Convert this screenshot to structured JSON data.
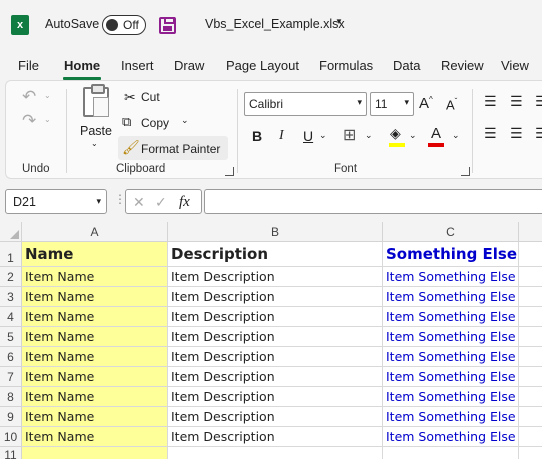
{
  "titlebar": {
    "app_icon": "excel-logo-icon",
    "app_icon_letter": "x",
    "autosave_label": "AutoSave",
    "autosave_state": "Off",
    "filename": "Vbs_Excel_Example.xlsx",
    "brand_color": "#107c41"
  },
  "menu": {
    "tabs": [
      "File",
      "Home",
      "Insert",
      "Draw",
      "Page Layout",
      "Formulas",
      "Data",
      "Review",
      "View"
    ],
    "active": "Home"
  },
  "ribbon": {
    "undo_group": {
      "label": "Undo"
    },
    "clipboard": {
      "label": "Clipboard",
      "paste": "Paste",
      "cut": "Cut",
      "copy": "Copy",
      "format_painter": "Format Painter"
    },
    "font": {
      "label": "Font",
      "font_name": "Calibri",
      "font_size": "11",
      "bold": "B",
      "italic": "I",
      "underline": "U",
      "grow": "A",
      "shrink": "A",
      "font_color_letter": "A",
      "highlight_color": "#ffff00",
      "font_color": "#e00000"
    }
  },
  "formula_bar": {
    "name_box": "D21",
    "fx_label": "fx",
    "cancel": "✕",
    "enter": "✓",
    "value": ""
  },
  "sheet": {
    "columns": [
      "A",
      "B",
      "C"
    ],
    "row_numbers": [
      "1",
      "2",
      "3",
      "4",
      "5",
      "6",
      "7",
      "8",
      "9",
      "10",
      "11"
    ],
    "header": {
      "a": "Name",
      "b": "Description",
      "c": "Something Else"
    },
    "rows": [
      {
        "a": "Item Name",
        "b": "Item Description",
        "c": "Item Something Else"
      },
      {
        "a": "Item Name",
        "b": "Item Description",
        "c": "Item Something Else"
      },
      {
        "a": "Item Name",
        "b": "Item Description",
        "c": "Item Something Else"
      },
      {
        "a": "Item Name",
        "b": "Item Description",
        "c": "Item Something Else"
      },
      {
        "a": "Item Name",
        "b": "Item Description",
        "c": "Item Something Else"
      },
      {
        "a": "Item Name",
        "b": "Item Description",
        "c": "Item Something Else"
      },
      {
        "a": "Item Name",
        "b": "Item Description",
        "c": "Item Something Else"
      },
      {
        "a": "Item Name",
        "b": "Item Description",
        "c": "Item Something Else"
      },
      {
        "a": "Item Name",
        "b": "Item Description",
        "c": "Item Something Else"
      }
    ],
    "colors": {
      "column_a_fill": "#ffff99",
      "column_c_text": "#0000cc"
    }
  }
}
